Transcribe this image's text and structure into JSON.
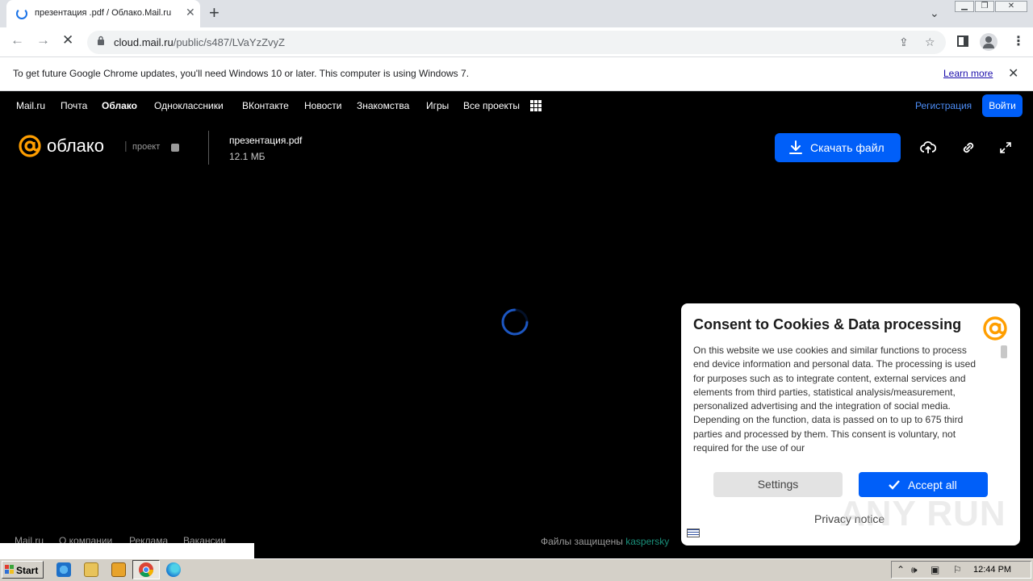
{
  "browser": {
    "tab": {
      "title": "презентация .pdf / Облако.Mail.ru"
    },
    "address": {
      "host": "cloud.mail.ru",
      "path": "/public/s487/LVaYzZvyZ"
    },
    "infobar": {
      "message": "To get future Google Chrome updates, you'll need Windows 10 or later. This computer is using Windows 7.",
      "learn_more": "Learn more"
    }
  },
  "portal": {
    "items": [
      "Mail.ru",
      "Почта",
      "Облако",
      "Одноклассники",
      "ВКонтакте",
      "Новости",
      "Знакомства",
      "Игры",
      "Все проекты"
    ],
    "active": "Облако",
    "register": "Регистрация",
    "login": "Войти"
  },
  "header": {
    "logo_text": "облако",
    "separator": "|",
    "project_label": "проект",
    "file_name": "презентация.pdf",
    "file_size": "12.1 МБ",
    "download_label": "Скачать файл"
  },
  "footer": {
    "links": [
      "Mail.ru",
      "О компании",
      "Реклама",
      "Вакансии"
    ],
    "protected_prefix": "Файлы защищены",
    "protected_brand": "kaspersky"
  },
  "consent": {
    "title": "Consent to Cookies & Data processing",
    "body": "On this website we use cookies and similar functions to process end device information and personal data. The processing is used for purposes such as to integrate content, external services and elements from third parties, statistical analysis/measurement, personalized advertising and the integration of social media. Depending on the function, data is passed on to up to 675 third parties and processed by them. This consent is voluntary, not required for the use of our",
    "settings_label": "Settings",
    "accept_label": "Accept all",
    "privacy_label": "Privacy notice"
  },
  "watermark": "ANY RUN",
  "taskbar": {
    "start_label": "Start",
    "clock": "12:44 PM"
  },
  "colors": {
    "accent_blue": "#005ff9",
    "link_blue": "#4d8ef7",
    "logo_orange": "#ff9e00",
    "kaspersky_green": "#1a8f7a"
  }
}
